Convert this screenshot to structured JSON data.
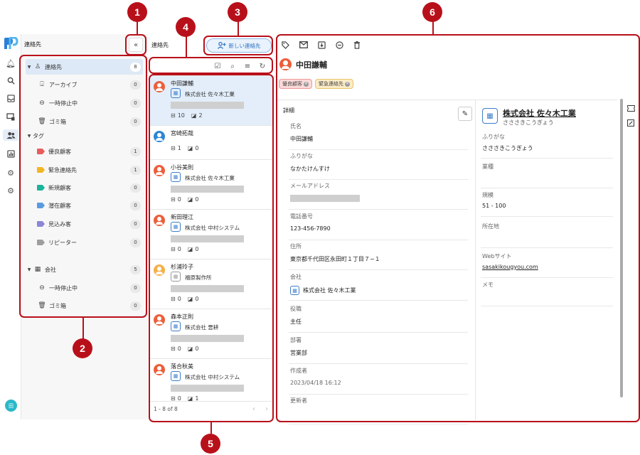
{
  "rail": {
    "icons": [
      "logo-icon",
      "bell-icon",
      "search-icon",
      "inbox-icon",
      "monitor-icon",
      "contacts-icon",
      "chart-icon",
      "settings-group-icon",
      "settings-icon"
    ],
    "user_initials": "田"
  },
  "nav": {
    "title": "連絡先",
    "collapse_label": "«",
    "items": [
      {
        "label": "連絡先",
        "count": "8",
        "icon": "person-icon",
        "caret": "▼",
        "selected": true
      },
      {
        "label": "アーカイブ",
        "count": "0",
        "icon": "archive-icon"
      },
      {
        "label": "一時停止中",
        "count": "0",
        "icon": "pause-icon"
      },
      {
        "label": "ゴミ箱",
        "count": "0",
        "icon": "trash-icon"
      },
      {
        "label": "タグ",
        "caret": "▼"
      },
      {
        "label": "優良顧客",
        "count": "1",
        "tag_color": "#e95c5c"
      },
      {
        "label": "緊急連絡先",
        "count": "1",
        "tag_color": "#f2b624"
      },
      {
        "label": "新規顧客",
        "count": "0",
        "tag_color": "#1bb39a"
      },
      {
        "label": "潜在顧客",
        "count": "0",
        "tag_color": "#5a9be0"
      },
      {
        "label": "見込み客",
        "count": "0",
        "tag_color": "#8c86d8"
      },
      {
        "label": "リピーター",
        "count": "0",
        "tag_color": "#9e9e9e"
      },
      {
        "label": "会社",
        "count": "5",
        "icon": "building-icon",
        "caret": "▼"
      },
      {
        "label": "一時停止中",
        "count": "0",
        "icon": "pause-icon"
      },
      {
        "label": "ゴミ箱",
        "count": "0",
        "icon": "trash-icon"
      }
    ]
  },
  "list": {
    "title": "連絡先",
    "new_button_label": "新しい連絡先",
    "tools": [
      "checklist-icon",
      "search-icon",
      "sort-icon",
      "refresh-icon"
    ],
    "cards": [
      {
        "name": "中田謙輔",
        "company": "株式会社 佐々木工業",
        "msgs": "10",
        "notes": "2",
        "avatar_color": "#ec5f3b",
        "selected": true
      },
      {
        "name": "宮崎拓哉",
        "company": "",
        "msgs": "1",
        "notes": "0",
        "avatar_color": "#2e86d6"
      },
      {
        "name": "小谷美則",
        "company": "株式会社 佐々木工業",
        "msgs": "0",
        "notes": "0",
        "avatar_color": "#ec5f3b"
      },
      {
        "name": "新田理江",
        "company": "株式会社 中村システム",
        "msgs": "0",
        "notes": "0",
        "avatar_color": "#ec5f3b"
      },
      {
        "name": "杉浦玲子",
        "company": "福原製作所",
        "msgs": "0",
        "notes": "0",
        "avatar_color": "#f5b04a",
        "company_grey": true
      },
      {
        "name": "森本正則",
        "company": "株式会社 雲耕",
        "msgs": "0",
        "notes": "0",
        "avatar_color": "#ec5f3b"
      },
      {
        "name": "落合秋美",
        "company": "株式会社 中村システム",
        "msgs": "0",
        "notes": "1",
        "avatar_color": "#ec5f3b"
      }
    ],
    "footer_range": "1 - 8 of 8",
    "prev": "‹",
    "next": "›"
  },
  "detail": {
    "toolbar": [
      "tag-icon",
      "mail-icon",
      "archive-icon",
      "pause-icon",
      "trash-icon"
    ],
    "name": "中田謙輔",
    "tags": [
      {
        "label": "優良顧客",
        "bg": "#fbd9d9",
        "border": "#e99"
      },
      {
        "label": "緊急連絡先",
        "bg": "#fbecc6",
        "border": "#e6c46a"
      }
    ],
    "section_title": "詳細",
    "fields": [
      {
        "label": "氏名",
        "value": "中田謙輔"
      },
      {
        "label": "ふりがな",
        "value": "なかたけんすけ"
      },
      {
        "label": "メールアドレス",
        "value": "",
        "blurred": true
      },
      {
        "label": "電話番号",
        "value": "123-456-7890"
      },
      {
        "label": "住所",
        "value": "東京都千代田区永田町１丁目７−１"
      },
      {
        "label": "会社",
        "value": "株式会社 佐々木工業",
        "company": true
      },
      {
        "label": "役職",
        "value": "主任"
      },
      {
        "label": "部署",
        "value": "営業部"
      },
      {
        "label": "作成者",
        "value": "2023/04/18 16:12",
        "muted": true
      },
      {
        "label": "更新者",
        "value": ""
      }
    ],
    "company": {
      "name": "株式会社 佐々木工業",
      "kana": "さささきこうぎょう",
      "fields": [
        {
          "label": "ふりがな",
          "value": "さささきこうぎょう"
        },
        {
          "label": "業種",
          "value": ""
        },
        {
          "label": "規模",
          "value": "51 - 100"
        },
        {
          "label": "所在地",
          "value": ""
        },
        {
          "label": "Webサイト",
          "value": "sasakikougyou.com",
          "link": true
        },
        {
          "label": "メモ",
          "value": ""
        }
      ]
    }
  },
  "callouts": [
    "1",
    "2",
    "3",
    "4",
    "5",
    "6"
  ],
  "colors": {
    "callout": "#b8101a",
    "accent": "#2d6fc0",
    "selected": "#dde9f6"
  }
}
